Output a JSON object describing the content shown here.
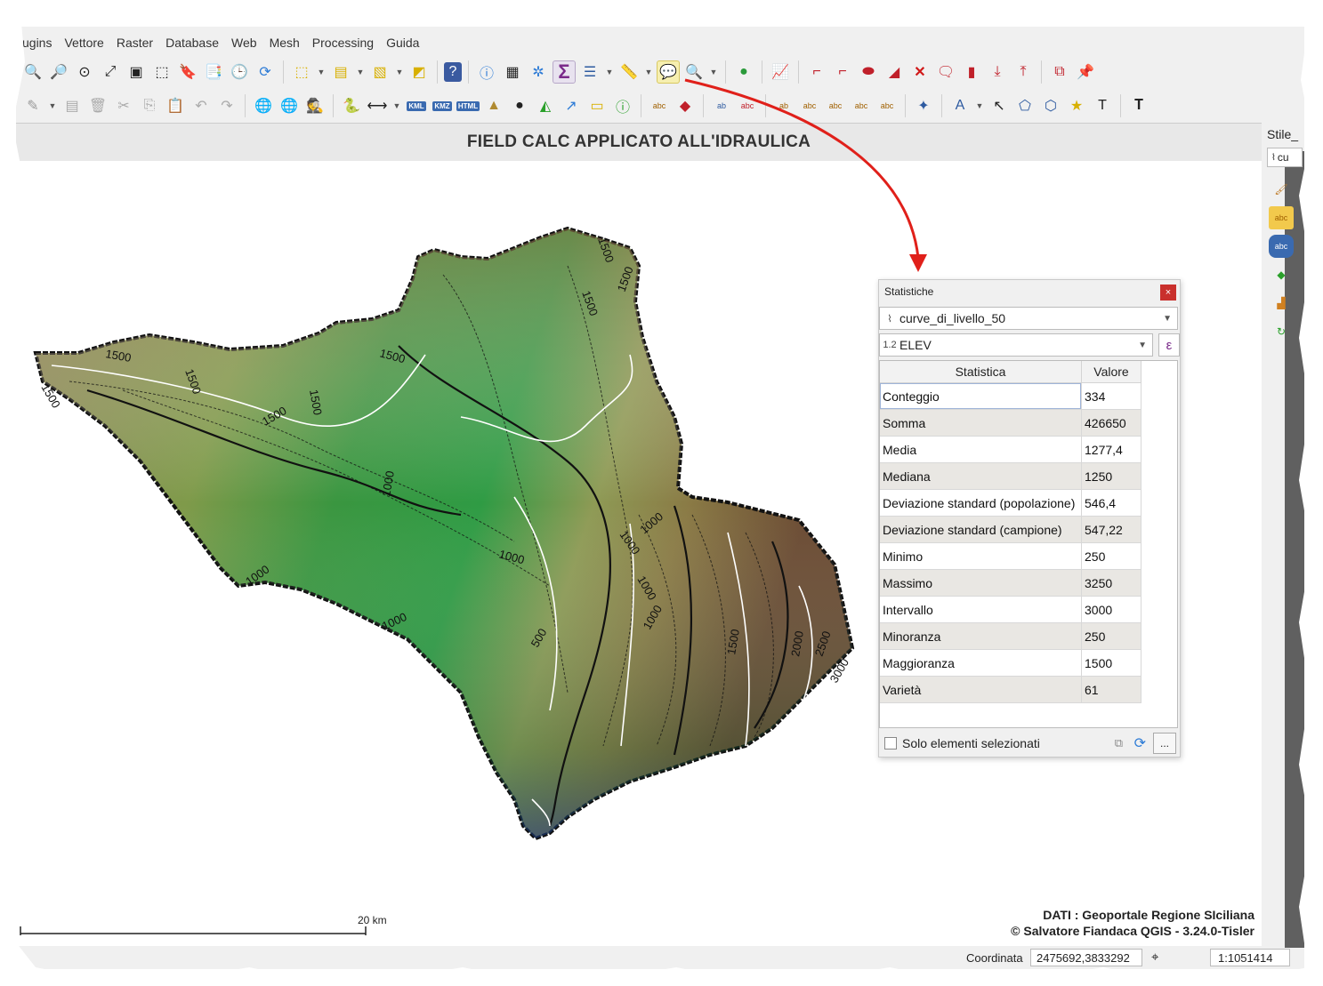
{
  "menu": {
    "items": [
      "ugins",
      "Vettore",
      "Raster",
      "Database",
      "Web",
      "Mesh",
      "Processing",
      "Guida"
    ]
  },
  "map": {
    "title": "FIELD CALC APPLICATO ALL'IDRAULICA",
    "scale_label": "20 km",
    "credits_line1": "DATI :  Geoportale Regione SIciliana",
    "credits_line2": "© Salvatore Fiandaca QGIS - 3.24.0-Tisler",
    "contour_labels": [
      "1500",
      "1500",
      "1500",
      "1500",
      "1500",
      "1500",
      "1500",
      "1500",
      "1500",
      "1000",
      "1000",
      "1000",
      "1000",
      "1000",
      "1000",
      "1000",
      "1000",
      "500",
      "1500",
      "2000",
      "2500",
      "3000"
    ]
  },
  "dock": {
    "style_label": "Stile_",
    "style_combo": "cu"
  },
  "status": {
    "coord_label": "Coordinata",
    "coord_value": "2475692,3833292",
    "scale_value": "1:1051414"
  },
  "stats_panel": {
    "title": "Statistiche",
    "close_label": "×",
    "layer": "curve_di_livello_50",
    "field_type": "1.2",
    "field": "ELEV",
    "expr_label": "ε",
    "headers": [
      "Statistica",
      "Valore"
    ],
    "rows": [
      {
        "stat": "Conteggio",
        "value": "334"
      },
      {
        "stat": "Somma",
        "value": "426650"
      },
      {
        "stat": "Media",
        "value": "1277,4"
      },
      {
        "stat": "Mediana",
        "value": "1250"
      },
      {
        "stat": "Deviazione standard (popolazione)",
        "value": "546,4"
      },
      {
        "stat": "Deviazione standard (campione)",
        "value": "547,22"
      },
      {
        "stat": "Minimo",
        "value": "250"
      },
      {
        "stat": "Massimo",
        "value": "3250"
      },
      {
        "stat": "Intervallo",
        "value": "3000"
      },
      {
        "stat": "Minoranza",
        "value": "250"
      },
      {
        "stat": "Maggioranza",
        "value": "1500"
      },
      {
        "stat": "Varietà",
        "value": "61"
      }
    ],
    "selected_only_label": "Solo elementi selezionati",
    "more_label": "..."
  },
  "colors": {
    "accent_arrow": "#e0201a",
    "close_red": "#c9302c",
    "sigma_purple": "#7a2a8a"
  },
  "toolbar1_icons": [
    "zoom-in-icon",
    "zoom-out-icon",
    "zoom-native-icon",
    "zoom-full-icon",
    "zoom-layer-icon",
    "zoom-selection-icon",
    "zoom-last-icon",
    "new-bookmark-icon",
    "bookmarks-icon",
    "temporal-icon",
    "refresh-icon",
    "select-features-icon",
    "select-value-icon",
    "deselect-icon",
    "select-location-icon",
    "help-icon",
    "identify-icon",
    "attribute-table-icon",
    "field-calculator-icon",
    "statistics-icon",
    "open-table-icon",
    "measure-icon",
    "map-tips-icon",
    "zoom-filter-icon",
    "share-icon",
    "profile-icon",
    "digitize-1-icon",
    "digitize-2-icon",
    "shape-icon",
    "eraser-icon",
    "delete-icon",
    "comment-icon",
    "bookmark-red-icon",
    "download-icon",
    "upload-icon",
    "copy-icon",
    "pin-icon"
  ],
  "toolbar2_icons": [
    "digitize-icon",
    "vertex-icon",
    "save-edits-icon",
    "delete-selected-icon",
    "cut-icon",
    "copy-features-icon",
    "paste-icon",
    "undo-icon",
    "redo-icon",
    "wms-icon",
    "wfs-icon",
    "spy-icon",
    "python-icon",
    "measure-line-icon",
    "kml-icon",
    "kmz-icon",
    "html-icon",
    "terrain-icon",
    "user-icon",
    "profile-tool-icon",
    "route-icon",
    "note-icon",
    "info-green-icon",
    "label-abc-icon",
    "cube-icon",
    "label-abc-2-icon",
    "label-abc-red-icon",
    "label-ab-icon",
    "label-eye-icon",
    "label-move-icon",
    "label-rotate-icon",
    "label-change-icon",
    "snap-icon",
    "text-annotation-icon",
    "select-cursor-icon",
    "node-icon",
    "node-edit-icon",
    "star-icon",
    "text-icon",
    "text-box-icon"
  ]
}
